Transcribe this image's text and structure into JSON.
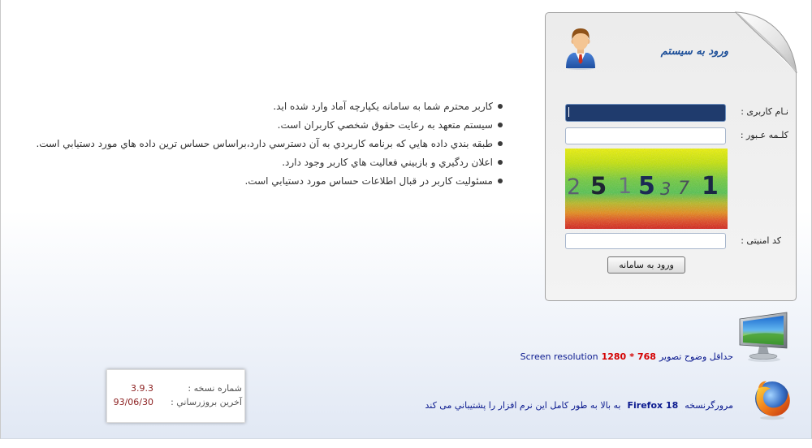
{
  "login": {
    "title": "ورود به سيستم",
    "username_label": "نـام کاربری :",
    "username_value": "",
    "password_label": "کلـمه عـبور :",
    "password_value": "",
    "captcha_label": "کد امنيتی :",
    "captcha_value": "",
    "submit_label": "ورود به سامانه"
  },
  "captcha": {
    "digits": [
      "2",
      "5",
      "1",
      "5",
      "3",
      "7",
      "1"
    ]
  },
  "info": {
    "items": [
      "کاربر محترم شما به سامانه يکپارچه آماد وارد شده ايد.",
      "سيستم متعهد به رعايت حقوق شخصي کاربران است.",
      "طبقه بندي داده هايي که برنامه کاربردي به آن دسترسي دارد،براساس حساس ترين داده هاي مورد دستيابي است.",
      "اعلان ردگيري و بازبيني فعاليت هاي کاربر وجود دارد.",
      "مسئوليت کاربر در قبال اطلاعات حساس مورد دستيابي است."
    ]
  },
  "requirements": {
    "resolution_label_en": "Screen resolution",
    "resolution_width": "1280",
    "resolution_separator": "*",
    "resolution_height": "768",
    "resolution_text": "حداقل وضوح تصوير",
    "browser_prefix": "مرورگرنسخه",
    "browser_name": "Firefox 18",
    "browser_suffix": "به بالا به طور کامل اين نرم افزار را پشتيباني مى کند"
  },
  "version": {
    "number_label": "شماره نسخه :",
    "number_value": "3.9.3",
    "updated_label": "آخرين بروزرساني :",
    "updated_value": "93/06/30"
  },
  "icons": {
    "avatar": "user-avatar-icon",
    "monitor": "monitor-icon",
    "browser": "firefox-icon",
    "corner": "page-curl"
  },
  "colors": {
    "title": "#1d4f99",
    "focused_field": "#1f3b6d",
    "highlight_red": "#d40000",
    "text_navy": "#0b1a8f",
    "version_value": "#8a1c1c"
  }
}
